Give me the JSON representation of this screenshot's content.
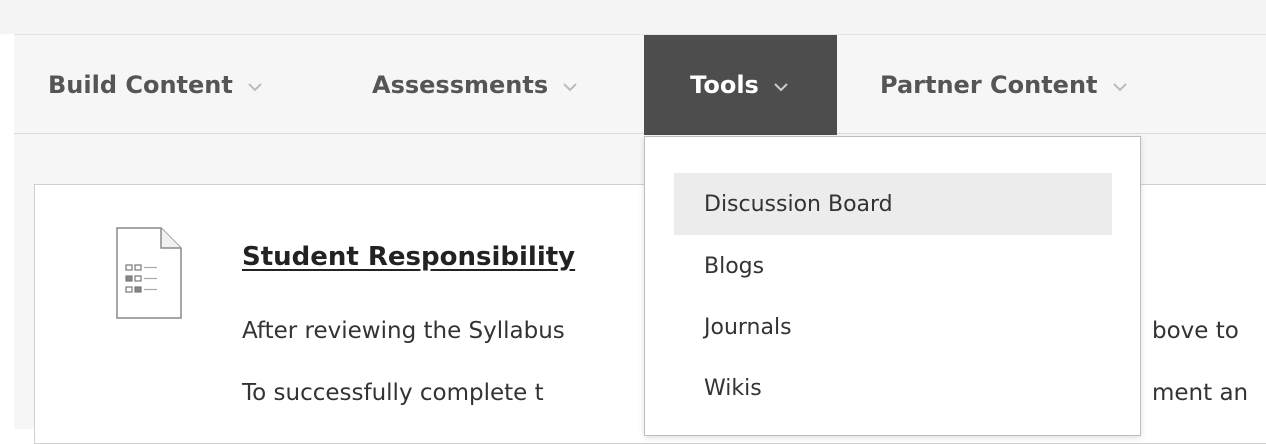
{
  "action_bar": {
    "items": [
      {
        "label": "Build Content",
        "icon": "chevron-down-icon"
      },
      {
        "label": "Assessments",
        "icon": "chevron-down-icon"
      },
      {
        "label": "Tools",
        "icon": "chevron-down-icon",
        "active": true
      },
      {
        "label": "Partner Content",
        "icon": "chevron-down-icon"
      }
    ]
  },
  "tools_menu": {
    "items": [
      {
        "label": "Discussion Board",
        "highlighted": true
      },
      {
        "label": "Blogs"
      },
      {
        "label": "Journals"
      },
      {
        "label": "Wikis"
      }
    ]
  },
  "content_item": {
    "icon": "document-icon",
    "title": "Student Responsibility",
    "line1": "After reviewing the Syllabus",
    "line1_right": "bove to",
    "line2": "To successfully complete t",
    "line2_right": "ment an"
  },
  "colors": {
    "active_tab_bg": "#4d4d4d",
    "bar_bg": "#f6f6f6",
    "menu_highlight": "#ececec",
    "menu_text": "#555555"
  }
}
